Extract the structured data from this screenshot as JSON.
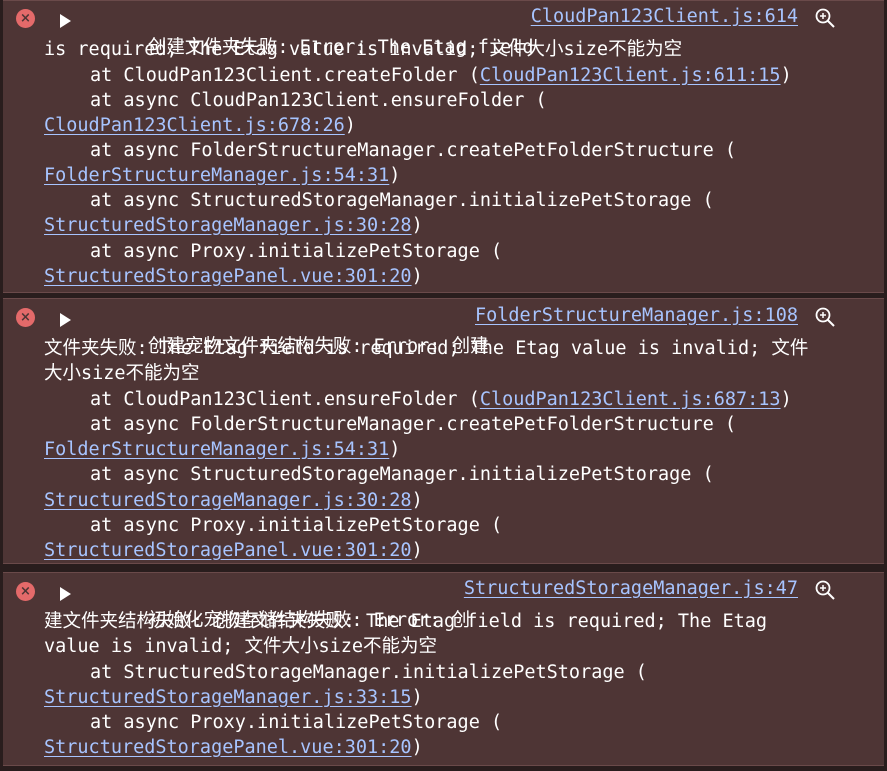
{
  "entries": [
    {
      "header_text": "创建文件夹失败: Error: The Etag field",
      "source": "CloudPan123Client.js:614",
      "lines": [
        {
          "pre": "is required; The Etag value is invalid; 文件大小size不能为空"
        },
        {
          "pre": "at CloudPan123Client.createFolder (",
          "link": "CloudPan123Client.js:611:15",
          "post": ")"
        },
        {
          "pre": "at async CloudPan123Client.ensureFolder ("
        },
        {
          "link": "CloudPan123Client.js:678:26",
          "post": ")"
        },
        {
          "pre": "at async FolderStructureManager.createPetFolderStructure ("
        },
        {
          "link": "FolderStructureManager.js:54:31",
          "post": ")"
        },
        {
          "pre": "at async StructuredStorageManager.initializePetStorage ("
        },
        {
          "link": "StructuredStorageManager.js:30:28",
          "post": ")"
        },
        {
          "pre": "at async Proxy.initializePetStorage ("
        },
        {
          "link": "StructuredStoragePanel.vue:301:20",
          "post": ")"
        }
      ]
    },
    {
      "header_text": "创建宠物文件夹结构失败: Error: 创建",
      "source": "FolderStructureManager.js:108",
      "lines": [
        {
          "pre": "文件夹失败: The Etag field is required; The Etag value is invalid; 文件"
        },
        {
          "pre": "大小size不能为空"
        },
        {
          "pre": "at CloudPan123Client.ensureFolder (",
          "link": "CloudPan123Client.js:687:13",
          "post": ")"
        },
        {
          "pre": "at async FolderStructureManager.createPetFolderStructure ("
        },
        {
          "link": "FolderStructureManager.js:54:31",
          "post": ")"
        },
        {
          "pre": "at async StructuredStorageManager.initializePetStorage ("
        },
        {
          "link": "StructuredStorageManager.js:30:28",
          "post": ")"
        },
        {
          "pre": "at async Proxy.initializePetStorage ("
        },
        {
          "link": "StructuredStoragePanel.vue:301:20",
          "post": ")"
        }
      ]
    },
    {
      "header_text": "初始化宠物存储结构失败: Error: 创",
      "source": "StructuredStorageManager.js:47",
      "lines": [
        {
          "pre": "建文件夹结构失败: 创建文件夹失败: The Etag field is required; The Etag"
        },
        {
          "pre": "value is invalid; 文件大小size不能为空"
        },
        {
          "pre": "at StructuredStorageManager.initializePetStorage ("
        },
        {
          "link": "StructuredStorageManager.js:33:15",
          "post": ")"
        },
        {
          "pre": "at async Proxy.initializePetStorage ("
        },
        {
          "link": "StructuredStoragePanel.vue:301:20",
          "post": ")"
        }
      ]
    }
  ],
  "icons": {
    "error": "×",
    "expand": "triangle-right-icon",
    "search": "magnifier-plus-icon"
  },
  "colors": {
    "background": "#291d1d",
    "entry_bg": "#4e3535",
    "text": "#ffffff",
    "link": "#a7c4ff",
    "error_icon": "#e46a6a"
  }
}
